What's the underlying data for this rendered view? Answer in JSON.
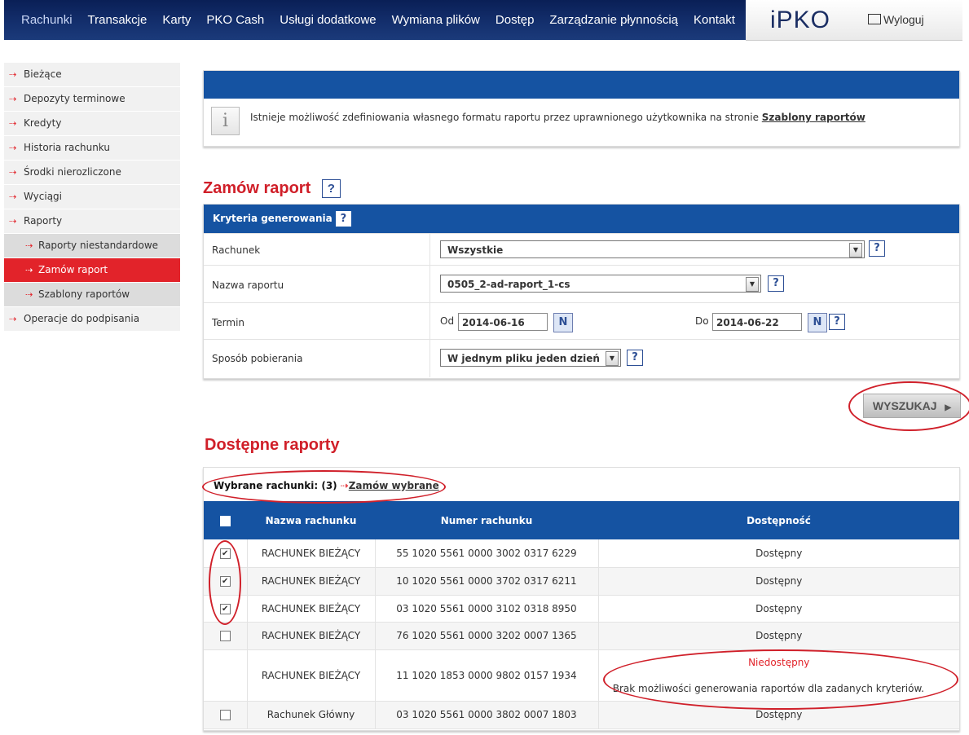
{
  "nav": {
    "items": [
      "Rachunki",
      "Transakcje",
      "Karty",
      "PKO Cash",
      "Usługi dodatkowe",
      "Wymiana plików",
      "Dostęp",
      "Zarządzanie płynnością",
      "Kontakt"
    ],
    "logo": "iPKO",
    "logout": "Wyloguj"
  },
  "sidebar": {
    "items": [
      {
        "label": "Bieżące"
      },
      {
        "label": "Depozyty terminowe"
      },
      {
        "label": "Kredyty"
      },
      {
        "label": "Historia rachunku"
      },
      {
        "label": "Środki nierozliczone"
      },
      {
        "label": "Wyciągi"
      },
      {
        "label": "Raporty"
      },
      {
        "label": "Raporty niestandardowe"
      },
      {
        "label": "Zamów raport"
      },
      {
        "label": "Szablony raportów"
      },
      {
        "label": "Operacje do podpisania"
      }
    ]
  },
  "info": {
    "text": "Istnieje możliwość zdefiniowania własnego formatu raportu przez uprawnionego użytkownika na stronie",
    "link": "Szablony raportów"
  },
  "order": {
    "title": "Zamów raport",
    "help": "?",
    "criteria_title": "Kryteria generowania",
    "account_label": "Rachunek",
    "account_value": "Wszystkie",
    "report_label": "Nazwa raportu",
    "report_value": "0505_2-ad-raport_1-cs",
    "term_label": "Termin",
    "from_label": "Od",
    "from_value": "2014-06-16",
    "to_label": "Do",
    "to_value": "2014-06-22",
    "method_label": "Sposób pobierania",
    "method_value": "W jednym pliku jeden dzień",
    "search_button": "WYSZUKAJ"
  },
  "reports": {
    "title": "Dostępne raporty",
    "selected_label": "Wybrane rachunki: (3)",
    "order_selected": "Zamów wybrane",
    "columns": [
      "Nazwa rachunku",
      "Numer rachunku",
      "Dostępność"
    ],
    "rows": [
      {
        "name": "RACHUNEK BIEŻĄCY",
        "number": "55 1020 5561 0000 3002 0317 6229",
        "status": "Dostępny",
        "checked": true
      },
      {
        "name": "RACHUNEK BIEŻĄCY",
        "number": "10 1020 5561 0000 3702 0317 6211",
        "status": "Dostępny",
        "checked": true
      },
      {
        "name": "RACHUNEK BIEŻĄCY",
        "number": "03 1020 5561 0000 3102 0318 8950",
        "status": "Dostępny",
        "checked": true
      },
      {
        "name": "RACHUNEK BIEŻĄCY",
        "number": "76 1020 5561 0000 3202 0007 1365",
        "status": "Dostępny",
        "checked": false
      },
      {
        "name": "RACHUNEK BIEŻĄCY",
        "number": "11 1020 1853 0000 9802 0157 1934",
        "status": "Niedostępny",
        "note": "Brak możliwości generowania raportów dla zadanych kryteriów.",
        "checked": null
      },
      {
        "name": "Rachunek Główny",
        "number": "03 1020 5561 0000 3802 0007 1803",
        "status": "Dostępny",
        "checked": false
      }
    ]
  },
  "colors": {
    "accent": "#e2232a",
    "header_blue": "#1553a2",
    "nav_dark": "#0a1f56"
  }
}
